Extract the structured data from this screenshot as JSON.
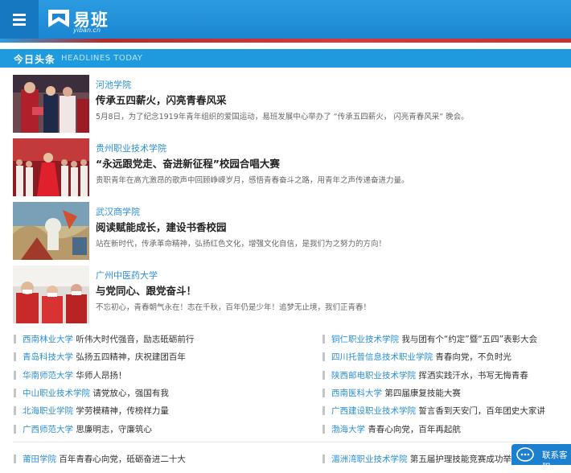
{
  "header": {
    "logo_text": "易班",
    "logo_sub": "yiban.cn"
  },
  "section": {
    "title": "今日头条",
    "subtitle": "HEADLINES TODAY"
  },
  "features": [
    {
      "school": "河池学院",
      "title": "传承五四薪火，闪亮青春风采",
      "desc": "5月8日，为了纪念1919年青年组织的爱国运动，易班发展中心举办了 “传承五四薪火， 闪亮青春风采” 晚会。"
    },
    {
      "school": "贵州职业技术学院",
      "title": "“永远跟党走、奋进新征程”校园合唱大赛",
      "desc": "贵职青年在高亢激昂的歌声中回顾峥嵘岁月，感悟青春奋斗之路，用青年之声传递奋进力量。"
    },
    {
      "school": "武汉商学院",
      "title": "阅读赋能成长，建设书香校园",
      "desc": "站在新时代，传承革命精神，弘扬红色文化，增强文化自信，是我们为之努力的方向！"
    },
    {
      "school": "广州中医药大学",
      "title": "与党同心、跟党奋斗！",
      "desc": "不忘初心，青春朝气永在！志在千秋，百年仍是少年！追梦无止境，我们正青春！"
    }
  ],
  "news_left": [
    {
      "school": "西南林业大学",
      "headline": "听伟大时代强音，励志砥砺前行"
    },
    {
      "school": "青岛科技大学",
      "headline": "弘扬五四精神，庆祝建团百年"
    },
    {
      "school": "华南师范大学",
      "headline": "华师人昂扬！"
    },
    {
      "school": "中山职业技术学院",
      "headline": "请党放心，强国有我"
    },
    {
      "school": "北海职业学院",
      "headline": "学劳模精神，传榜样力量"
    },
    {
      "school": "广西师范大学",
      "headline": "思廉明志，守廉筑心"
    },
    {
      "school": "莆田学院",
      "headline": "百年青春心向党，砥砺奋进二十大"
    }
  ],
  "news_right": [
    {
      "school": "铜仁职业技术学院",
      "headline": "我与团有个“约定”暨“五四”表彰大会"
    },
    {
      "school": "四川托普信息技术职业学院",
      "headline": "青春向党，不负时光"
    },
    {
      "school": "陕西邮电职业技术学院",
      "headline": "挥洒实践汗水，书写无悔青春"
    },
    {
      "school": "西南医科大学",
      "headline": "第四届康复技能大赛"
    },
    {
      "school": "广西建设职业技术学院",
      "headline": "誓言香到天安门，百年团史大家讲"
    },
    {
      "school": "渤海大学",
      "headline": "青春心向党，百年再起航"
    },
    {
      "school": "湄洲湾职业技术学院",
      "headline": "第五届护理技能竞赛成功举办"
    }
  ],
  "service": {
    "label": "联系客服"
  },
  "colors": {
    "brand_blue": "#1e9ade",
    "link_blue": "#2b8fd7",
    "accent_red": "#d93a3a"
  }
}
